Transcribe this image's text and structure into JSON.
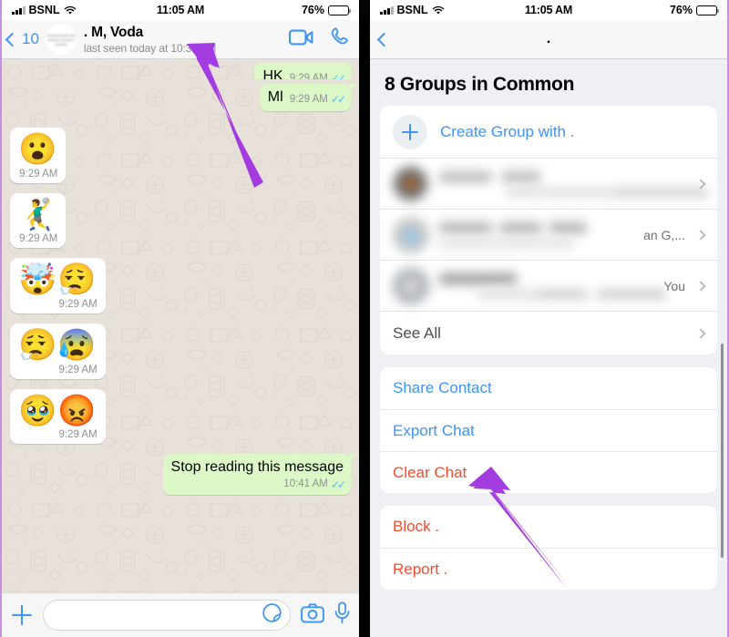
{
  "status_bar": {
    "carrier": "BSNL",
    "time": "11:05 AM",
    "battery_percent": "76%",
    "wifi_icon": "wifi-icon",
    "signal_icon": "cellular-bars-icon",
    "battery_icon": "battery-icon"
  },
  "left_panel": {
    "header": {
      "back_icon": "chevron-left-icon",
      "back_count": "10",
      "avatar_icon": "contact-avatar",
      "avatar_blur_text": "aaaaaaaaaaaa aaaaaaaaaa aaaaaa aaaaaaaa",
      "contact_name": ". M, Voda",
      "last_seen": "last seen today at 10:31 AM",
      "video_call_icon": "video-call-icon",
      "voice_call_icon": "phone-call-icon"
    },
    "messages": [
      {
        "kind": "text-out-clipped",
        "text": "HK",
        "time": "9:29 AM",
        "ticks": "read-receipt-double-check"
      },
      {
        "kind": "text-out",
        "text": "Ml",
        "time": "9:29 AM",
        "ticks": "read-receipt-double-check"
      },
      {
        "kind": "sticker-in",
        "emojis": "😮",
        "time": "9:29 AM"
      },
      {
        "kind": "sticker-in",
        "emojis": "🤾‍♂️",
        "time": "9:29 AM"
      },
      {
        "kind": "sticker-in",
        "emojis": "🤯😮‍💨",
        "time": "9:29 AM"
      },
      {
        "kind": "sticker-in",
        "emojis": "😮‍💨😰",
        "time": "9:29 AM"
      },
      {
        "kind": "sticker-in",
        "emojis": "🥹😡",
        "time": "9:29 AM"
      },
      {
        "kind": "text-out-last",
        "text": "Stop reading this message",
        "time": "10:41 AM",
        "ticks": "read-receipt-double-check"
      }
    ],
    "input_bar": {
      "attach_icon": "plus-icon",
      "message_placeholder": "",
      "sticker_icon": "sticker-icon",
      "camera_icon": "camera-icon",
      "mic_icon": "microphone-icon"
    }
  },
  "right_panel": {
    "navbar": {
      "back_icon": "chevron-left-icon",
      "title": "."
    },
    "section_title": "8 Groups in Common",
    "create_group": {
      "plus_icon": "plus-circle-icon",
      "label": "Create Group with ."
    },
    "group_rows": [
      {
        "name_blurred": true,
        "trailing": "",
        "chevron": "chevron-right-icon"
      },
      {
        "name_blurred": true,
        "trailing": "an G,...",
        "chevron": "chevron-right-icon"
      },
      {
        "name_blurred": true,
        "trailing": "You",
        "chevron": "chevron-right-icon"
      }
    ],
    "see_all": {
      "label": "See All",
      "chevron": "chevron-right-icon"
    },
    "actions_primary": [
      {
        "label": "Share Contact",
        "style": "blue"
      },
      {
        "label": "Export Chat",
        "style": "blue"
      },
      {
        "label": "Clear Chat",
        "style": "red"
      }
    ],
    "actions_danger": [
      {
        "label": "Block .",
        "style": "red"
      },
      {
        "label": "Report .",
        "style": "red"
      }
    ]
  },
  "annotations": {
    "arrow_color": "#a33ce0",
    "arrow_left_target": "last-seen-text",
    "arrow_right_target": "clear-chat-row"
  }
}
